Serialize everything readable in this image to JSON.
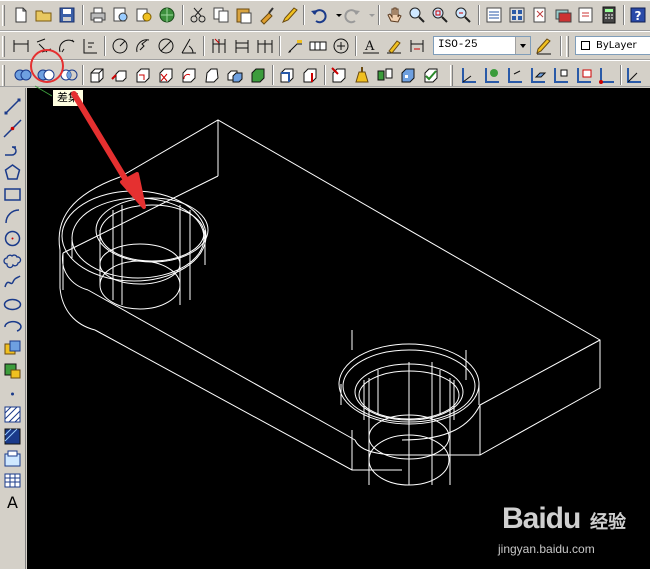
{
  "toolbar_top": {
    "icons": [
      "new-icon",
      "open-icon",
      "save-icon",
      "print-icon",
      "plot-preview-icon",
      "publish-icon",
      "3d-dwf-icon",
      "cut-icon",
      "copy-icon",
      "paste-icon",
      "match-properties-icon",
      "undo-icon",
      "redo-icon",
      "pan-icon",
      "zoom-realtime-icon",
      "zoom-window-icon",
      "zoom-previous-icon",
      "properties-icon",
      "design-center-icon",
      "tool-palettes-icon",
      "sheet-set-icon",
      "markup-icon",
      "calculator-icon",
      "help-icon"
    ]
  },
  "toolbar_dim": {
    "icons": [
      "linear-dim-icon",
      "aligned-dim-icon",
      "arc-length-icon",
      "ordinate-icon",
      "radius-icon",
      "jogged-icon",
      "diameter-icon",
      "angular-icon",
      "quick-dim-icon",
      "baseline-icon",
      "continue-icon",
      "quick-leader-icon",
      "tolerance-icon",
      "center-mark-icon",
      "dim-edit-icon",
      "dim-text-edit-icon",
      "dim-update-icon"
    ],
    "dim_style": "ISO-25",
    "layer_value": "ByLayer"
  },
  "toolbar_solids": {
    "icons": [
      "union-icon",
      "subtract-icon",
      "intersect-icon",
      "extrude-faces-icon",
      "move-faces-icon",
      "offset-faces-icon",
      "delete-faces-icon",
      "rotate-faces-icon",
      "taper-faces-icon",
      "copy-faces-icon",
      "color-faces-icon",
      "copy-edges-icon",
      "color-edges-icon",
      "imprint-icon",
      "clean-icon",
      "separate-icon",
      "shell-icon",
      "check-icon",
      "ucs-icon",
      "ucs-world-icon",
      "ucs-previous-icon",
      "ucs-face-icon",
      "ucs-object-icon",
      "ucs-view-icon",
      "ucs-origin-icon"
    ]
  },
  "draw_toolbar": {
    "icons": [
      "line-icon",
      "construction-line-icon",
      "polyline-icon",
      "polygon-icon",
      "rectangle-icon",
      "arc-icon",
      "circle-icon",
      "revision-cloud-icon",
      "spline-icon",
      "ellipse-icon",
      "ellipse-arc-icon",
      "insert-block-icon",
      "make-block-icon",
      "point-icon",
      "hatch-icon",
      "gradient-icon",
      "region-icon",
      "table-icon",
      "multiline-text-icon"
    ],
    "text_label": "A"
  },
  "tooltip": {
    "text": "差集"
  },
  "watermark": {
    "logo": "Baidu",
    "cn": "经验",
    "url": "jingyan.baidu.com"
  },
  "colors": {
    "canvas": "#000000",
    "wire": "#ffffff",
    "annotation": "#e53030",
    "toolbar": "#d4d0c8"
  }
}
